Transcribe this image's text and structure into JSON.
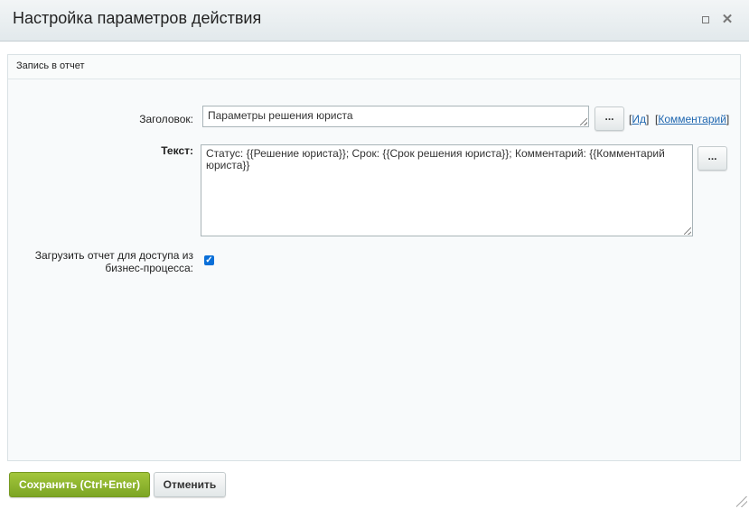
{
  "dialog": {
    "title": "Настройка параметров действия",
    "maximize_icon": "maximize-icon",
    "close_icon": "close-icon",
    "close_glyph": "✕"
  },
  "panel": {
    "title": "Запись в отчет"
  },
  "form": {
    "heading_label": "Заголовок:",
    "heading_value": "Параметры решения юриста",
    "dots_label": "...",
    "link_id": "Ид",
    "link_comment": "Комментарий",
    "text_label": "Текст:",
    "text_value": "Статус: {{Решение юриста}}; Срок: {{Срок решения юриста}}; Комментарий: {{Комментарий юриста}}",
    "upload_label": "Загрузить отчет для доступа из бизнес-процесса:",
    "upload_checked": true
  },
  "footer": {
    "save_label": "Сохранить (Ctrl+Enter)",
    "cancel_label": "Отменить"
  },
  "colors": {
    "save_button": "#8ab42e",
    "link": "#2067b0",
    "checkbox": "#0a6fd8"
  }
}
